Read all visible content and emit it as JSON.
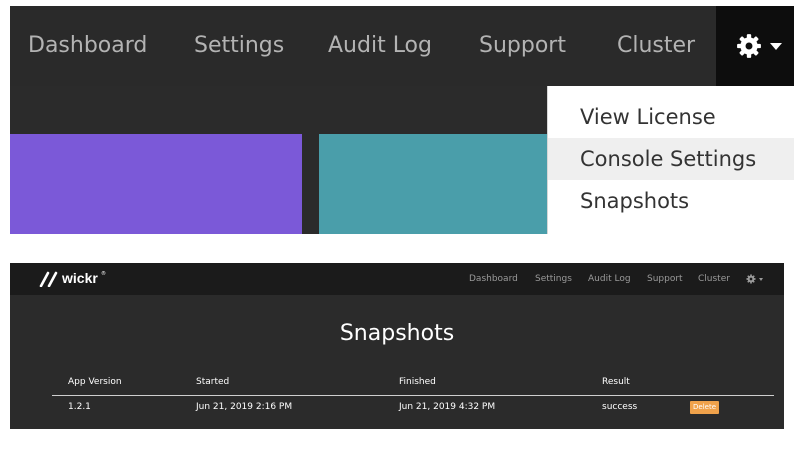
{
  "top_panel": {
    "nav": {
      "items": [
        "Dashboard",
        "Settings",
        "Audit Log",
        "Support",
        "Cluster"
      ]
    },
    "dropdown": {
      "items": [
        "View License",
        "Console Settings",
        "Snapshots"
      ],
      "hovered": "Console Settings"
    }
  },
  "bottom_panel": {
    "logo_text": "wickr",
    "logo_mark": "®",
    "nav": {
      "items": [
        "Dashboard",
        "Settings",
        "Audit Log",
        "Support",
        "Cluster"
      ]
    },
    "page_title": "Snapshots",
    "table": {
      "columns": [
        "App Version",
        "Started",
        "Finished",
        "Result"
      ],
      "rows": [
        {
          "app_version": "1.2.1",
          "started": "Jun 21, 2019 2:16 PM",
          "finished": "Jun 21, 2019 4:32 PM",
          "result": "success",
          "action": "Delete"
        }
      ]
    }
  },
  "colors": {
    "nav_background": "#2a2a2a",
    "page_background": "#2b2b2b",
    "tile_purple": "#7b59d8",
    "tile_teal": "#4a9eaa",
    "delete_button": "#f0a24b"
  },
  "icons": [
    "gear-icon",
    "chevron-down-icon",
    "wickr-logo"
  ]
}
